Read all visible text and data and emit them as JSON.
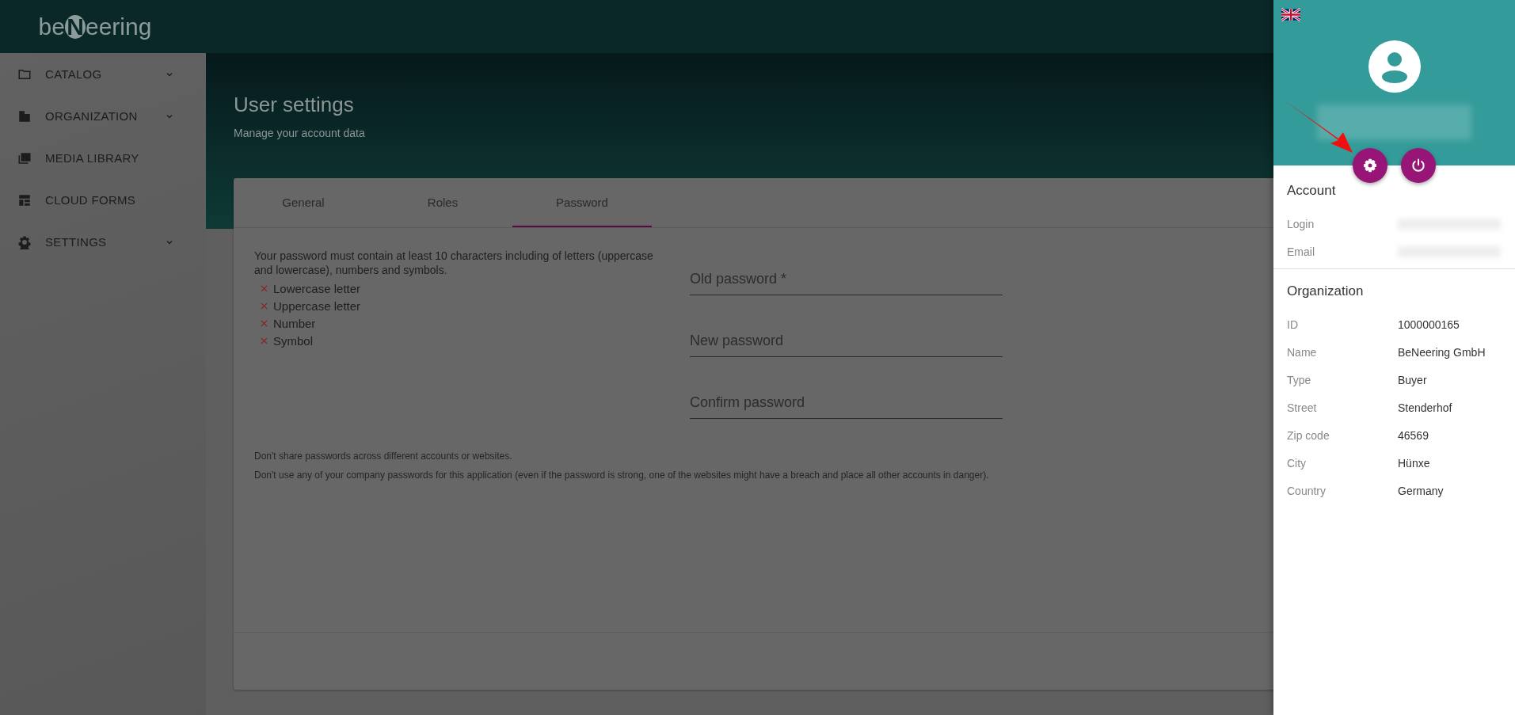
{
  "logo": {
    "before": "be",
    "mark": "N",
    "after": "eering"
  },
  "sidebar": {
    "items": [
      {
        "label": "CATALOG",
        "expandable": true
      },
      {
        "label": "ORGANIZATION",
        "expandable": true
      },
      {
        "label": "MEDIA LIBRARY",
        "expandable": false
      },
      {
        "label": "CLOUD FORMS",
        "expandable": false
      },
      {
        "label": "SETTINGS",
        "expandable": true
      }
    ]
  },
  "header": {
    "title": "User settings",
    "subtitle": "Manage your account data"
  },
  "tabs": [
    {
      "label": "General",
      "selected": false
    },
    {
      "label": "Roles",
      "selected": false
    },
    {
      "label": "Password",
      "selected": true
    }
  ],
  "password": {
    "rules_intro": "Your password must contain at least 10 characters including of letters (uppercase and lowercase), numbers and symbols.",
    "rules": [
      {
        "label": "Lowercase letter",
        "met": false
      },
      {
        "label": "Uppercase letter",
        "met": false
      },
      {
        "label": "Number",
        "met": false
      },
      {
        "label": "Symbol",
        "met": false
      }
    ],
    "fields": [
      {
        "placeholder": "Old password *"
      },
      {
        "placeholder": "New password"
      },
      {
        "placeholder": "Confirm password"
      }
    ],
    "notes": [
      "Don't share passwords across different accounts or websites.",
      "Don't use any of your company passwords for this application (even if the password is strong, one of the websites might have a breach and place all other accounts in danger)."
    ]
  },
  "profile_panel": {
    "sections": [
      {
        "title": "Account",
        "rows": [
          {
            "label": "Login"
          },
          {
            "label": "Email"
          }
        ]
      },
      {
        "title": "Organization",
        "rows": [
          {
            "label": "ID",
            "value": "1000000165"
          },
          {
            "label": "Name",
            "value": "BeNeering GmbH"
          },
          {
            "label": "Type",
            "value": "Buyer"
          },
          {
            "label": "Street",
            "value": "Stenderhof"
          },
          {
            "label": "Zip code",
            "value": "46569"
          },
          {
            "label": "City",
            "value": "Hünxe"
          },
          {
            "label": "Country",
            "value": "Germany"
          }
        ]
      }
    ]
  }
}
